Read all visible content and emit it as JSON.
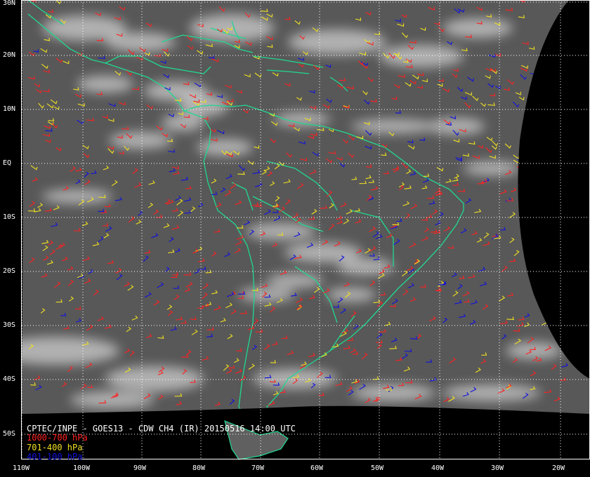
{
  "title": "CPTEC/INPE - GOES13 - CDW CH4 (IR) 20150516 14:00 UTC",
  "legend": [
    {
      "label": "1000-700 hPa",
      "color": "#ff2020"
    },
    {
      "label": "701-400 hPa",
      "color": "#f0e020"
    },
    {
      "label": "401-100 hPa",
      "color": "#1010e0"
    }
  ],
  "lat_labels": [
    "30N",
    "20N",
    "10N",
    "EQ",
    "10S",
    "20S",
    "30S",
    "40S",
    "50S"
  ],
  "lon_labels": [
    "110W",
    "100W",
    "90W",
    "80W",
    "70W",
    "60W",
    "50W",
    "40W",
    "30W",
    "20W"
  ],
  "colors": {
    "coastline": "#20d890",
    "grid": "#ffffff",
    "background": "#000000",
    "earth_disk": "#585858"
  }
}
